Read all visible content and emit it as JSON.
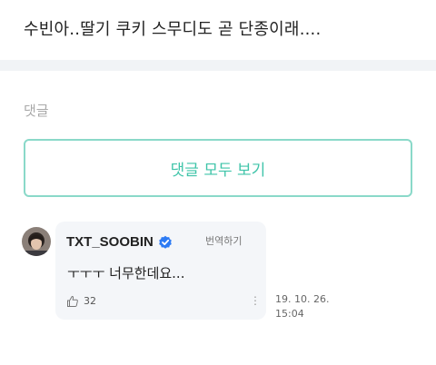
{
  "post": {
    "text": "수빈아..딸기 쿠키 스무디도 곧 단종이래...."
  },
  "comments_section": {
    "heading": "댓글",
    "view_all_label": "댓글 모두 보기"
  },
  "comment": {
    "username": "TXT_SOOBIN",
    "verified": true,
    "translate_label": "번역하기",
    "text": "ㅜㅜㅜ 너무한데요...",
    "like_count": "32",
    "date": "19. 10. 26.",
    "time": "15:04"
  },
  "colors": {
    "accent": "#3fc4a9",
    "button_border": "#8ad9c9",
    "verified_badge": "#2d7bf4",
    "divider": "#f1f3f6",
    "bubble": "#f4f6f9"
  },
  "icons": [
    "verified-badge-icon",
    "thumbs-up-icon",
    "more-options-icon",
    "avatar"
  ]
}
